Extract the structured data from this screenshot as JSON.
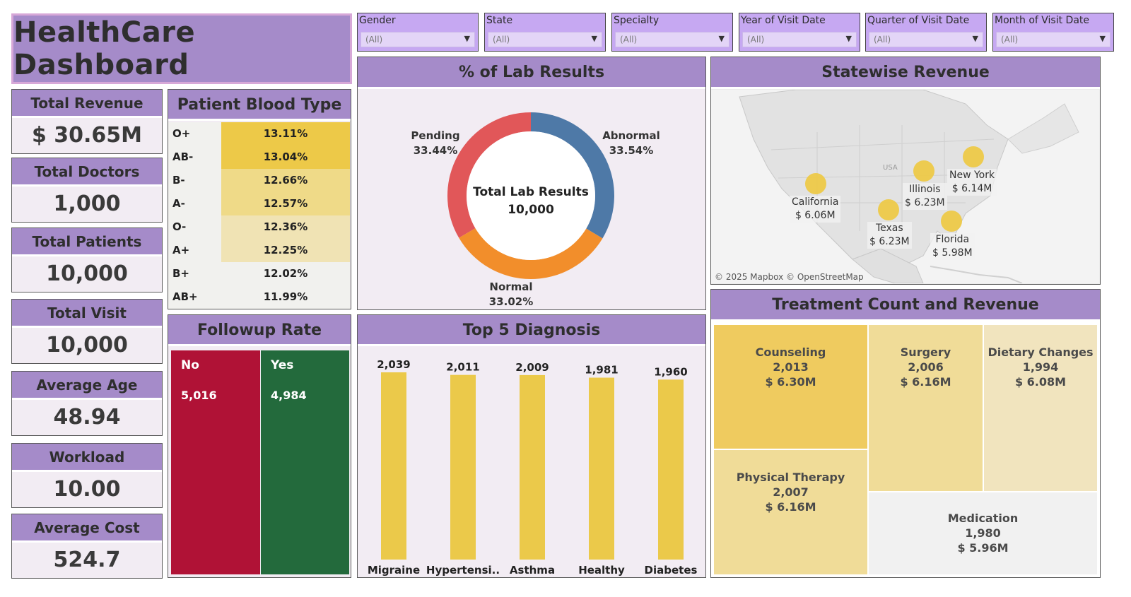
{
  "title": "HealthCare Dashboard",
  "filters": [
    {
      "label": "Gender",
      "value": "(All)"
    },
    {
      "label": "State",
      "value": "(All)"
    },
    {
      "label": "Specialty",
      "value": "(All)"
    },
    {
      "label": "Year of Visit Date",
      "value": "(All)"
    },
    {
      "label": "Quarter of Visit Date",
      "value": "(All)"
    },
    {
      "label": "Month of Visit Date",
      "value": "(All)"
    }
  ],
  "kpis": [
    {
      "label": "Total Revenue",
      "value": "$ 30.65M"
    },
    {
      "label": "Total Doctors",
      "value": "1,000"
    },
    {
      "label": "Total Patients",
      "value": "10,000"
    },
    {
      "label": "Total Visit",
      "value": "10,000"
    },
    {
      "label": "Average Age",
      "value": "48.94"
    },
    {
      "label": "Workload",
      "value": "10.00"
    },
    {
      "label": "Average Cost",
      "value": "524.7"
    }
  ],
  "blood_type": {
    "title": "Patient Blood Type",
    "rows": [
      {
        "type": "O+",
        "pct": "13.11%",
        "color": "#edc948"
      },
      {
        "type": "AB-",
        "pct": "13.04%",
        "color": "#edc948"
      },
      {
        "type": "B-",
        "pct": "12.66%",
        "color": "#efda88"
      },
      {
        "type": "A-",
        "pct": "12.57%",
        "color": "#efda88"
      },
      {
        "type": "O-",
        "pct": "12.36%",
        "color": "#f0e3b4"
      },
      {
        "type": "A+",
        "pct": "12.25%",
        "color": "#f0e3b4"
      },
      {
        "type": "B+",
        "pct": "12.02%",
        "color": "#f1f1ee"
      },
      {
        "type": "AB+",
        "pct": "11.99%",
        "color": "#f1f1ee"
      }
    ]
  },
  "followup": {
    "title": "Followup Rate",
    "no_label": "No",
    "no_value": "5,016",
    "no_color": "#b01236",
    "yes_label": "Yes",
    "yes_value": "4,984",
    "yes_color": "#236a3c"
  },
  "lab": {
    "title": "% of Lab Results",
    "center_label": "Total Lab Results",
    "center_value": "10,000",
    "abnormal_label": "Abnormal",
    "abnormal_pct": "33.54%",
    "pending_label": "Pending",
    "pending_pct": "33.44%",
    "normal_label": "Normal",
    "normal_pct": "33.02%"
  },
  "map": {
    "title": "Statewise Revenue",
    "country_label": "USA",
    "credit": "© 2025 Mapbox © OpenStreetMap",
    "states": [
      {
        "name": "California",
        "value": "$ 6.06M"
      },
      {
        "name": "Illinois",
        "value": "$ 6.23M"
      },
      {
        "name": "New York",
        "value": "$ 6.14M"
      },
      {
        "name": "Texas",
        "value": "$ 6.23M"
      },
      {
        "name": "Florida",
        "value": "$ 5.98M"
      }
    ]
  },
  "treatment": {
    "title": "Treatment Count and Revenue",
    "items": [
      {
        "name": "Counseling",
        "count": "2,013",
        "revenue": "$ 6.30M",
        "color": "#efcb5f"
      },
      {
        "name": "Surgery",
        "count": "2,006",
        "revenue": "$ 6.16M",
        "color": "#f0dc98"
      },
      {
        "name": "Dietary Changes",
        "count": "1,994",
        "revenue": "$ 6.08M",
        "color": "#f1e4be"
      },
      {
        "name": "Physical Therapy",
        "count": "2,007",
        "revenue": "$ 6.16M",
        "color": "#f0dc98"
      },
      {
        "name": "Medication",
        "count": "1,980",
        "revenue": "$ 5.96M",
        "color": "#f1f1f1"
      }
    ]
  },
  "diagnosis": {
    "title": "Top 5 Diagnosis",
    "bar_color": "#ebc94a"
  },
  "chart_data": [
    {
      "type": "pie",
      "title": "% of Lab Results",
      "categories": [
        "Abnormal",
        "Normal",
        "Pending"
      ],
      "values": [
        33.54,
        33.02,
        33.44
      ],
      "colors": [
        "#4e79a7",
        "#f28e2b",
        "#e15759"
      ]
    },
    {
      "type": "bar",
      "title": "Top 5 Diagnosis",
      "categories": [
        "Migraine",
        "Hypertensi..",
        "Asthma",
        "Healthy",
        "Diabetes"
      ],
      "values": [
        2039,
        2011,
        2009,
        1981,
        1960
      ],
      "labels": [
        "2,039",
        "2,011",
        "2,009",
        "1,981",
        "1,960"
      ]
    },
    {
      "type": "table",
      "title": "Patient Blood Type",
      "categories": [
        "O+",
        "AB-",
        "B-",
        "A-",
        "O-",
        "A+",
        "B+",
        "AB+"
      ],
      "values": [
        13.11,
        13.04,
        12.66,
        12.57,
        12.36,
        12.25,
        12.02,
        11.99
      ]
    },
    {
      "type": "bar",
      "title": "Followup Rate",
      "categories": [
        "No",
        "Yes"
      ],
      "values": [
        5016,
        4984
      ]
    }
  ]
}
